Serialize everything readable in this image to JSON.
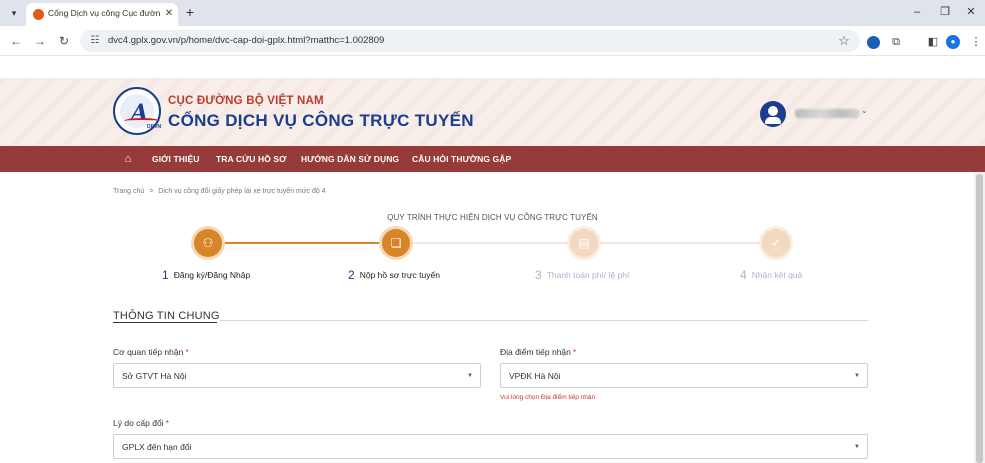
{
  "browser": {
    "tab_title": "Cổng Dịch vụ công Cục đường bộ",
    "url": "dvc4.gplx.gov.vn/p/home/dvc-cap-doi-gplx.html?matthc=1.002809",
    "window_buttons": {
      "minimize": "–",
      "restore": "❐",
      "close": "✕"
    }
  },
  "header": {
    "org_name": "CỤC ĐƯỜNG BỘ VIỆT NAM",
    "portal_name": "CỔNG DỊCH VỤ CÔNG TRỰC TUYẾN",
    "logo_text": "DRVN"
  },
  "nav": {
    "items": [
      "GIỚI THIỆU",
      "TRA CỨU HỒ SƠ",
      "HƯỚNG DẪN SỬ DỤNG",
      "CÂU HỎI THƯỜNG GẶP"
    ]
  },
  "breadcrumb": {
    "home": "Trang chủ",
    "separator": ">",
    "current": "Dịch vụ công đổi giấy phép lái xe trực tuyến mức độ 4"
  },
  "process": {
    "title": "QUY TRÌNH THỰC HIỆN DỊCH VỤ CÔNG TRỰC TUYẾN",
    "steps": [
      {
        "num": "1",
        "label": "Đăng ký/Đăng Nhập",
        "icon": "user-icon",
        "status": "done"
      },
      {
        "num": "2",
        "label": "Nộp hồ sơ trực tuyến",
        "icon": "document-icon",
        "status": "current"
      },
      {
        "num": "3",
        "label": "Thanh toán phí/ lệ phí",
        "icon": "receipt-icon",
        "status": "pending"
      },
      {
        "num": "4",
        "label": "Nhận kết quả",
        "icon": "check-icon",
        "status": "pending"
      }
    ]
  },
  "form": {
    "section_title": "THÔNG TIN CHUNG",
    "co_quan": {
      "label": "Cơ quan tiếp nhận",
      "required": "*",
      "value": "Sở GTVT Hà Nội"
    },
    "dia_diem": {
      "label": "Địa điểm tiếp nhận",
      "required": "*",
      "value": "VPĐK Hà Nội",
      "error": "Vui lòng chọn Địa điểm tiếp nhận"
    },
    "ly_do": {
      "label": "Lý do cấp đổi",
      "required": "*",
      "value": "GPLX đến hạn đổi"
    }
  },
  "colors": {
    "nav_bg": "#963a3a",
    "brand_blue": "#1b3d8f",
    "brand_red": "#c0392b",
    "step_active": "#d8852a",
    "step_inactive": "#f2d9c0"
  }
}
